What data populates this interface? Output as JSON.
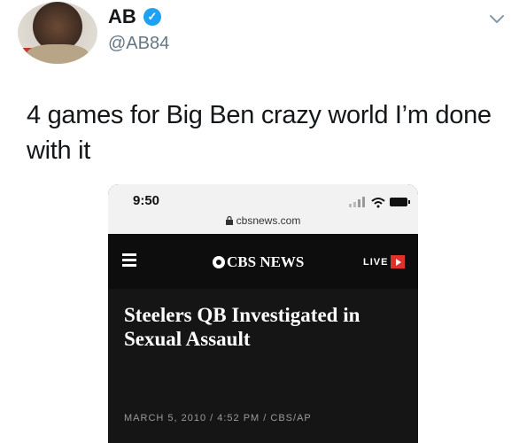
{
  "tweet": {
    "author_name": "AB",
    "handle": "@AB84",
    "text": "4 games for Big Ben crazy world I’m done with it",
    "verified_mark": "✓"
  },
  "embedded_screenshot": {
    "status_time": "9:50",
    "url": "cbsnews.com",
    "logo_text": "CBS NEWS",
    "live_label": "LIVE",
    "headline": "Steelers QB Investigated in Sexual Assault",
    "byline": "MARCH 5, 2010 / 4:52 PM / CBS/AP"
  },
  "icons": {
    "verified": "verified-badge-icon",
    "menu_chevron": "chevron-down-icon",
    "signal": "signal-wifi-battery-icon",
    "lock": "lock-icon",
    "menu": "hamburger-menu-icon",
    "cbs_eye": "cbs-eye-icon",
    "live_play": "play-icon"
  },
  "colors": {
    "verified_blue": "#1da1f2",
    "handle_gray": "#657786",
    "live_red": "#e0312b",
    "article_bg": "#151515"
  }
}
